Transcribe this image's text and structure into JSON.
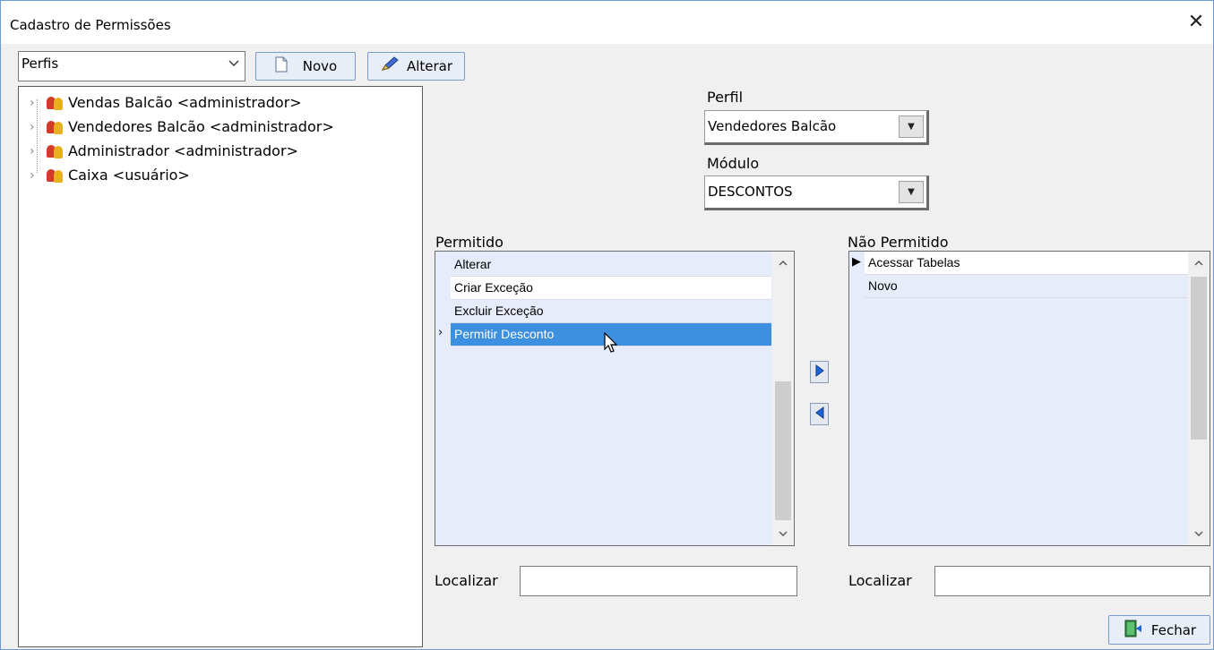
{
  "window": {
    "title": "Cadastro de Permissões",
    "close_glyph": "✕"
  },
  "toolbar": {
    "type_select": "Perfis",
    "new_label": "Novo",
    "edit_label": "Alterar"
  },
  "tree": {
    "items": [
      {
        "label": "Vendas Balcão <administrador>"
      },
      {
        "label": "Vendedores Balcão <administrador>"
      },
      {
        "label": "Administrador <administrador>"
      },
      {
        "label": "Caixa <usuário>"
      }
    ]
  },
  "profile": {
    "label": "Perfil",
    "value": "Vendedores Balcão"
  },
  "module": {
    "label": "Módulo",
    "value": "DESCONTOS"
  },
  "allowed": {
    "label": "Permitido",
    "rows": [
      "Alterar",
      "Criar Exceção",
      "Excluir Exceção",
      "Permitir Desconto"
    ],
    "selected_index": 3,
    "search_label": "Localizar",
    "search_value": ""
  },
  "denied": {
    "label": "Não Permitido",
    "rows": [
      "Acessar Tabelas",
      "Novo"
    ],
    "current_index": 0,
    "search_label": "Localizar",
    "search_value": ""
  },
  "close_button": {
    "label": "Fechar"
  },
  "icons": {
    "group": "users-group-icon",
    "move_right": "arrow-right-icon",
    "move_left": "arrow-left-icon",
    "door": "exit-door-icon"
  },
  "colors": {
    "selection": "#3d8fe0",
    "grid_bg": "#e6ecfa",
    "border_accent": "#7b9ccc"
  }
}
